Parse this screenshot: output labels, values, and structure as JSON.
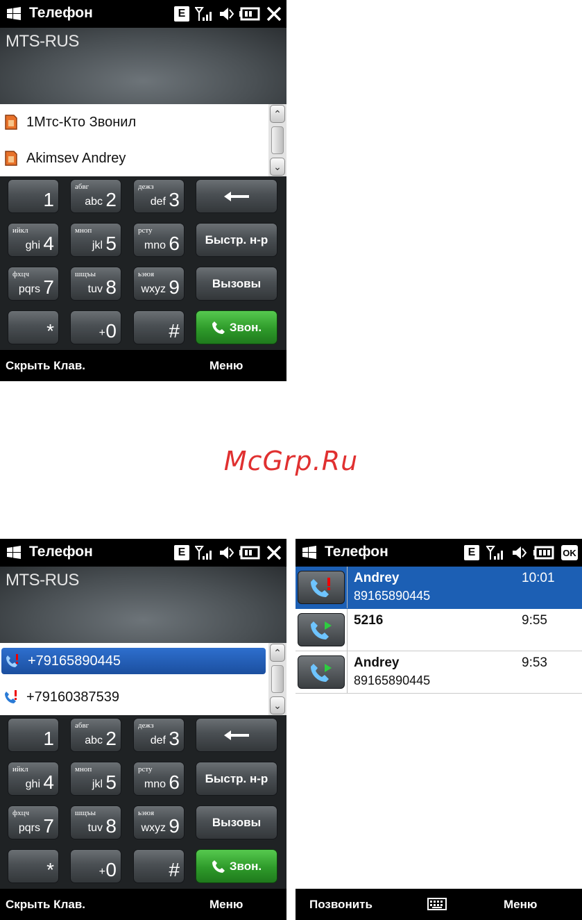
{
  "watermark": "McGrp.Ru",
  "screen1": {
    "title": "Телефон",
    "net_badge": "E",
    "operator": "MTS-RUS",
    "list": [
      {
        "label": "1Мтс-Кто Звонил",
        "icon": "sim-contact-icon"
      },
      {
        "label": "Akimsev Andrey",
        "icon": "sim-contact-icon"
      }
    ],
    "keys": [
      {
        "digit": "1",
        "lat": "",
        "cyr": ""
      },
      {
        "digit": "2",
        "lat": "abc",
        "cyr": "абвг"
      },
      {
        "digit": "3",
        "lat": "def",
        "cyr": "дежз"
      },
      {
        "digit": "4",
        "lat": "ghi",
        "cyr": "ийкл"
      },
      {
        "digit": "5",
        "lat": "jkl",
        "cyr": "мноп"
      },
      {
        "digit": "6",
        "lat": "mno",
        "cyr": "рсту"
      },
      {
        "digit": "7",
        "lat": "pqrs",
        "cyr": "фхцч"
      },
      {
        "digit": "8",
        "lat": "tuv",
        "cyr": "шщъы"
      },
      {
        "digit": "9",
        "lat": "wxyz",
        "cyr": "ьэюя"
      },
      {
        "digit": "*",
        "lat": "",
        "cyr": ""
      },
      {
        "digit": "0",
        "lat": "+",
        "cyr": ""
      },
      {
        "digit": "#",
        "lat": "",
        "cyr": ""
      }
    ],
    "speed_dial": "Быстр. н-р",
    "calls": "Вызовы",
    "dial": "Звон.",
    "soft_left": "Скрыть Клав.",
    "soft_right": "Меню"
  },
  "screen2": {
    "title": "Телефон",
    "net_badge": "E",
    "operator": "MTS-RUS",
    "list": [
      {
        "label": "+79165890445",
        "icon": "missed-call-icon",
        "selected": true
      },
      {
        "label": "+79160387539",
        "icon": "missed-call-icon",
        "selected": false
      }
    ],
    "speed_dial": "Быстр. н-р",
    "calls": "Вызовы",
    "dial": "Звон.",
    "soft_left": "Скрыть Клав.",
    "soft_right": "Меню"
  },
  "screen3": {
    "title": "Телефон",
    "net_badge": "E",
    "ok_badge": "OK",
    "calls": [
      {
        "name": "Andrey",
        "number": "89165890445",
        "time": "10:01",
        "type": "missed",
        "selected": true
      },
      {
        "name": "5216",
        "number": "",
        "time": "9:55",
        "type": "outgoing",
        "selected": false
      },
      {
        "name": "Andrey",
        "number": "89165890445",
        "time": "9:53",
        "type": "outgoing",
        "selected": false
      }
    ],
    "soft_left": "Позвонить",
    "soft_right": "Меню"
  }
}
